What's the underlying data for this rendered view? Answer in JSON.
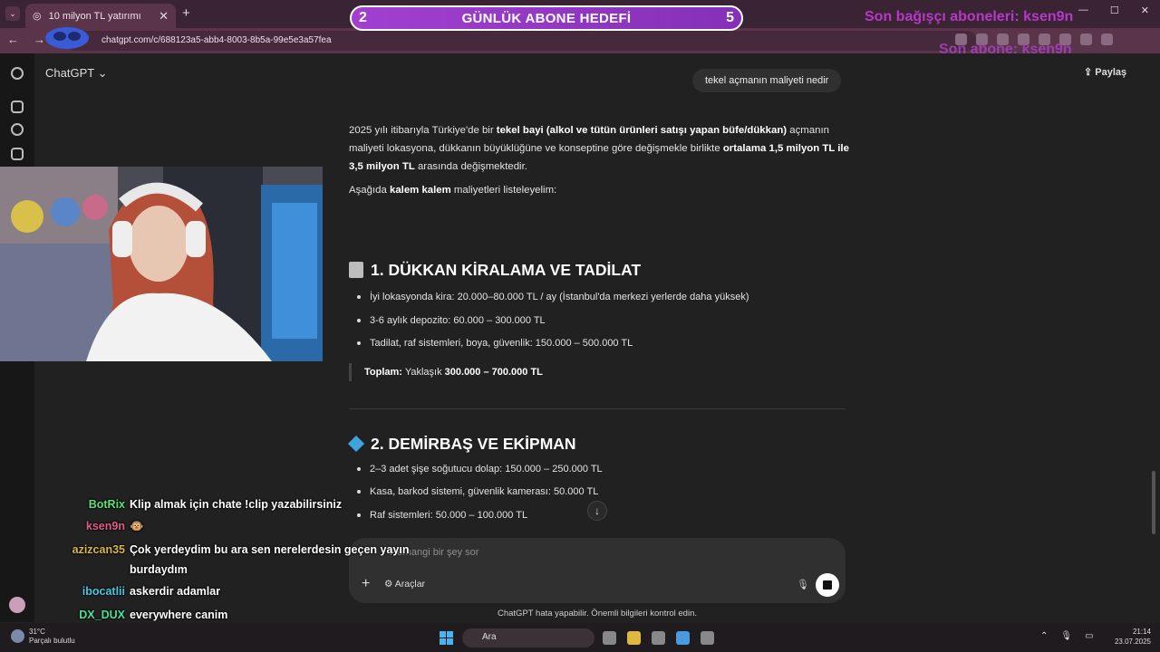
{
  "browser": {
    "tab_title": "10 milyon TL yatırımı",
    "url": "chatgpt.com/c/688123a5-abb4-8003-8b5a-99e5e3a57fea"
  },
  "overlay": {
    "goal_current": "2",
    "goal_title": "GÜNLÜK ABONE HEDEFİ",
    "goal_target": "5",
    "last_donor": "Son bağışçı aboneleri: ksen9n",
    "last_sub": "Son abone: ksen9n"
  },
  "chatgpt": {
    "app_name": "ChatGPT",
    "share_label": "Paylaş",
    "user_message": "tekel açmanın maliyeti nedir",
    "answer": {
      "intro_1": "2025 yılı itibarıyla Türkiye'de bir",
      "intro_bold_1": "tekel bayi (alkol ve tütün ürünleri satışı yapan büfe/dükkan)",
      "intro_2": "açmanın maliyeti lokasyona, dükkanın büyüklüğüne ve konseptine göre değişmekle birlikte",
      "intro_bold_2": "ortalama 1,5 milyon TL ile 3,5 milyon TL",
      "intro_3": "arasında değişmektedir.",
      "list_1": "Aşağıda",
      "list_bold": "kalem kalem",
      "list_2": "maliyetleri listeleyelim:",
      "section1_title": "1. DÜKKAN KİRALAMA VE TADİLAT",
      "section1_items": [
        "İyi lokasyonda kira: 20.000–80.000 TL / ay (İstanbul'da merkezi yerlerde daha yüksek)",
        "3-6 aylık depozito: 60.000 – 300.000 TL",
        "Tadilat, raf sistemleri, boya, güvenlik: 150.000 – 500.000 TL"
      ],
      "section1_total_label": "Toplam:",
      "section1_total_text": "Yaklaşık",
      "section1_total_value": "300.000 – 700.000 TL",
      "section2_title": "2. DEMİRBAŞ VE EKİPMAN",
      "section2_items": [
        "2–3 adet şişe soğutucu dolap: 150.000 – 250.000 TL",
        "Kasa, barkod sistemi, güvenlik kamerası: 50.000 TL",
        "Raf sistemleri: 50.000 – 100.000 TL"
      ]
    },
    "composer_placeholder": "Herhangi bir şey sor",
    "tools_label": "Araçlar",
    "disclaimer": "ChatGPT hata yapabilir. Önemli bilgileri kontrol edin."
  },
  "stream_chat": [
    {
      "user": "BotRix",
      "color": "#5ce07a",
      "message": "Klip almak için chate !clip yazabilirsiniz"
    },
    {
      "user": "ksen9n",
      "color": "#e05c8a",
      "message": "🐵"
    },
    {
      "user": "azizcan35",
      "color": "#d8b84a",
      "message": "Çok yerdeydim bu ara sen nerelerdesin geçen yayın"
    },
    {
      "user": "",
      "color": "#fff",
      "message": "burdaydım"
    },
    {
      "user": "ibocatlii",
      "color": "#4ac8e0",
      "message": "askerdir adamlar"
    },
    {
      "user": "DX_DUX",
      "color": "#4ae0a0",
      "message": "everywhere canim"
    }
  ],
  "taskbar": {
    "temperature": "31°C",
    "weather": "Parçalı bulutlu",
    "search": "Ara",
    "time": "21:14",
    "date": "23.07.2025"
  },
  "colors": {
    "goal_bar": "#a23fd1",
    "overlay_text": "#b638c8",
    "tab_bar": "#3a2433"
  }
}
